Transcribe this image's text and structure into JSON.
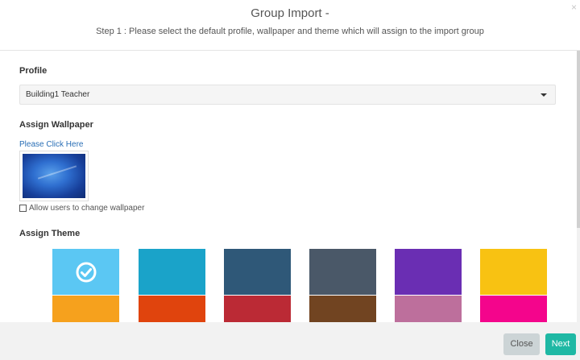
{
  "header": {
    "title": "Group Import -",
    "subtitle": "Step 1 : Please select the default profile, wallpaper and theme which will assign to the import group",
    "close_icon": "×"
  },
  "profile": {
    "label": "Profile",
    "selected": "Building1 Teacher"
  },
  "wallpaper": {
    "label": "Assign Wallpaper",
    "link": "Please Click Here",
    "allow_change_label": "Allow users to change wallpaper",
    "allow_change_checked": false
  },
  "theme": {
    "label": "Assign Theme",
    "selected_index": 0,
    "colors": [
      "#5bc7f3",
      "#1aa3c9",
      "#2f5878",
      "#4a5868",
      "#6a2eb3",
      "#f8c212",
      "#f6a11d",
      "#e0440d",
      "#bb2a35",
      "#714421",
      "#bd6f9c",
      "#f4058c"
    ]
  },
  "footer": {
    "close_label": "Close",
    "next_label": "Next"
  }
}
